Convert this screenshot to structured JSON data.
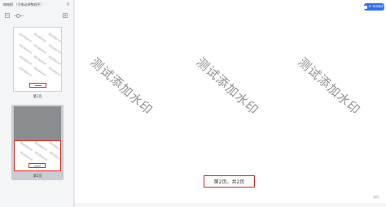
{
  "sidebar": {
    "title": "缩略图 （可拖动调整顺序）",
    "close_icon": "close-icon",
    "thumbnails": [
      {
        "label": "第1页",
        "selected": false
      },
      {
        "label": "第2页",
        "selected": true
      }
    ]
  },
  "document": {
    "watermark_text": "测试添加水印",
    "footer_text": "第2页，共2页"
  },
  "ai_badge": {
    "label": "AI 写作助手"
  },
  "corner_logo": {
    "label": "福昕"
  },
  "colors": {
    "highlight_red": "#d9221b",
    "ai_blue": "#2f6fe6",
    "sidebar_bg": "#f4f5f7"
  }
}
